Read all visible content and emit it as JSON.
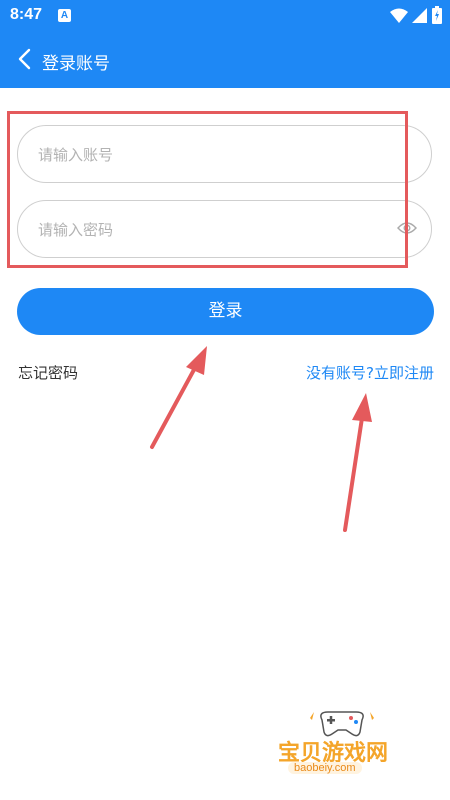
{
  "status_bar": {
    "time": "8:47",
    "notification_letter": "A"
  },
  "app_bar": {
    "title": "登录账号"
  },
  "form": {
    "account_placeholder": "请输入账号",
    "password_placeholder": "请输入密码",
    "login_label": "登录",
    "forgot_password_label": "忘记密码",
    "register_label": "没有账号?立即注册"
  },
  "watermark": {
    "brand": "宝贝游戏网",
    "url": "baobeiy.com"
  },
  "colors": {
    "primary": "#1e88f5",
    "annotation_red": "#e45a5c"
  }
}
